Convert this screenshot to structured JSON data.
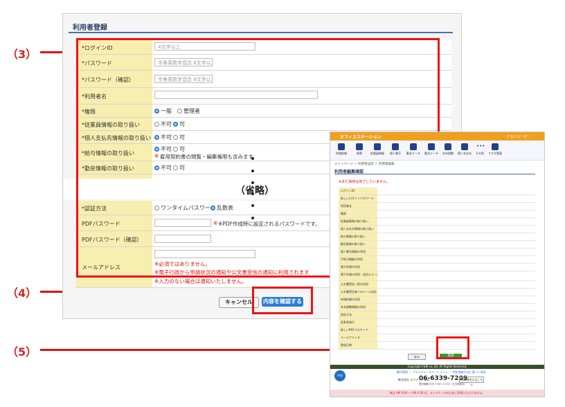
{
  "callouts": {
    "c3": "（3）",
    "c4": "（4）",
    "c5": "（5）"
  },
  "form": {
    "title": "利用者登録",
    "rows": {
      "login_id": {
        "label": "*ログインID",
        "placeholder": "4文字以上"
      },
      "password": {
        "label": "*パスワード",
        "placeholder": "半角英数字混合 8文字以上"
      },
      "password_confirm": {
        "label": "*パスワード（確認）",
        "placeholder": "半角英数字混合 8文字以上"
      },
      "user_name": {
        "label": "*利用者名"
      },
      "authority": {
        "label": "*権限",
        "opt1": "一般",
        "opt2": "管理者"
      },
      "employee_info": {
        "label": "*従業員情報の取り扱い",
        "opt1": "不可",
        "opt2": "可"
      },
      "personal_payment": {
        "label": "*個人支払先情報の取り扱い",
        "opt1": "不可",
        "opt2": "可"
      },
      "salary_info": {
        "label": "*給与情報の取り扱い",
        "opt1": "不可",
        "opt2": "可",
        "note": "雇用契約書の閲覧・編集権限も含みます"
      },
      "attendance_info": {
        "label": "*勤怠情報の取り扱い",
        "opt1": "不可",
        "opt2": "可"
      },
      "auth_method": {
        "label": "*認証方法",
        "opt1": "ワンタイムパスワード",
        "opt2": "乱数表"
      },
      "pdf_password": {
        "label": "PDFパスワード",
        "note": "※PDF作成時に設定されるパスワードです。"
      },
      "pdf_password_confirm": {
        "label": "PDFパスワード（確認）"
      },
      "email": {
        "label": "メールアドレス",
        "note1": "※必須ではありません。",
        "note2": "※電子行政から申請状況の通知や公文書受信の通知に利用されます",
        "note3": "※入力のない場合は通知いたしません。"
      }
    },
    "cancel": "キャンセル",
    "confirm": "内容を確認する"
  },
  "omit": "（省略）",
  "shot2": {
    "brand": "オフィスステーション",
    "user": "テストユーザー",
    "nav": [
      "申請依頼",
      "帳票",
      "従業員情報",
      "個人番号",
      "勤怠データ",
      "勤怠データ",
      "年末調整",
      "個人支払先",
      "その他",
      "マスタ管理"
    ],
    "breadcrumb": "メインページ ＞ 利用者設定 ＞ 利用者編集",
    "title": "利用者編集確認",
    "warning": "※まだ保存は完了していません。",
    "rows": [
      "ログインID",
      "新しいログインパスワード",
      "利用者名",
      "権限",
      "従業員情報の取り扱い",
      "個人支払先情報の取り扱い",
      "給与情報の取り扱い",
      "勤怠情報の取り扱い",
      "個人番号情報の利用",
      "手続き機能の利用",
      "電子申請の利用",
      "電子申請の利用・送信エラー選択",
      "公文書受信一覧の利用",
      "公文書受信者へのメール送信",
      "申請依頼の利用",
      "年末調整情報の利用",
      "認証方法",
      "乱数表発行",
      "新しいPDFパスワード",
      "メールアドレス",
      "登録日時"
    ],
    "back": "戻る",
    "register": "登録",
    "copyright": "Copyright F&M co.,ltd. All Rights Reserved.",
    "links": "動作環境 ｜ プライバシーステートメント ｜ 特定商取引法に基づく表記",
    "company": "株式会社 エフアンドエム",
    "tel": "06-6339-7209",
    "info": "受付時間 平日 9:00〜17:00（土日祝休み）",
    "badge": "Web問合せはこちら",
    "logo": "FAQ",
    "bottom_note": "毎日 AM 4:00 〜 AM 4:30 は、メンテナンスのためご利用いただけません。"
  }
}
